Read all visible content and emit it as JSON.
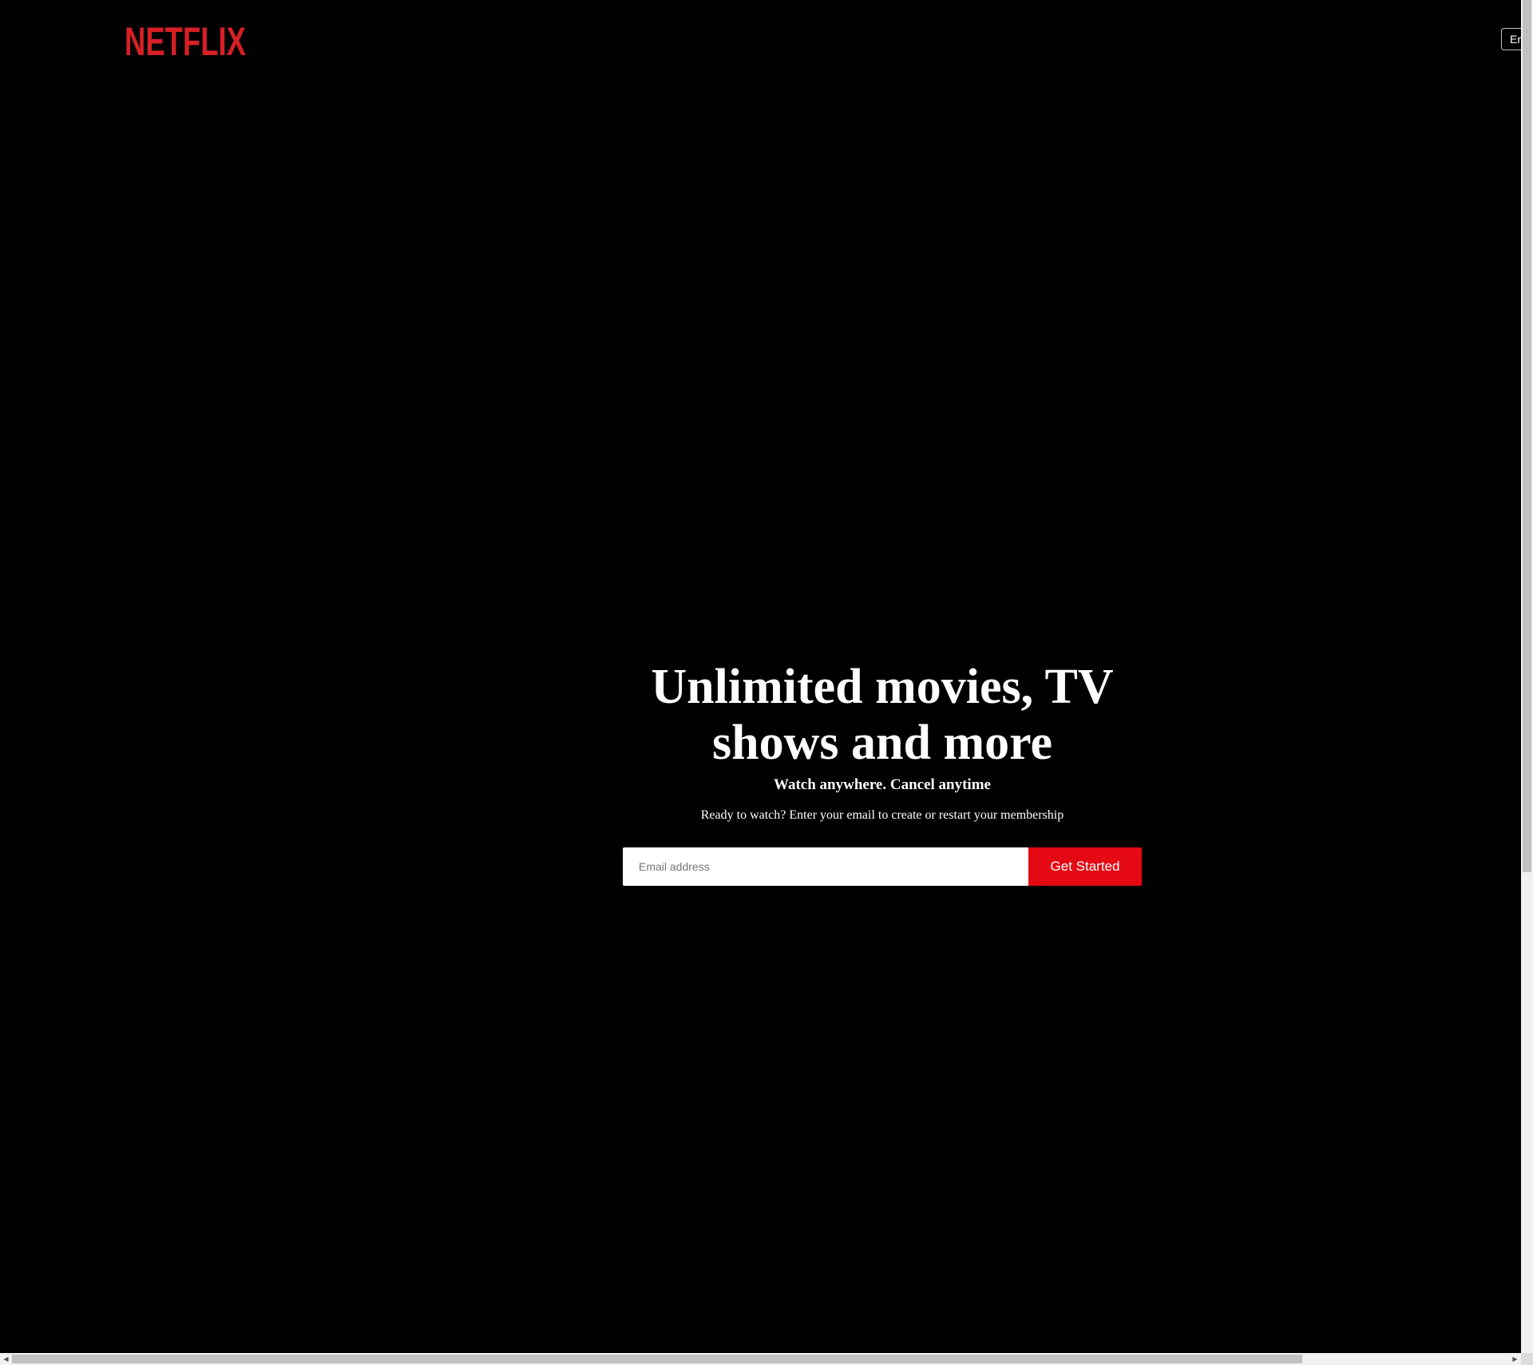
{
  "brand": {
    "name": "NETFLIX",
    "color": "#e50914",
    "logo_color": "#d81f26"
  },
  "header": {
    "language_button_label": "En"
  },
  "hero": {
    "title": "Unlimited movies, TV shows and more",
    "subtitle": "Watch anywhere. Cancel anytime",
    "cta_text": "Ready to watch? Enter your email to create or restart your membership",
    "email_placeholder": "Email address",
    "email_value": "",
    "get_started_label": "Get Started"
  },
  "icons": {
    "scroll_left": "scroll-left-arrow-icon",
    "scroll_right": "scroll-right-arrow-icon"
  }
}
